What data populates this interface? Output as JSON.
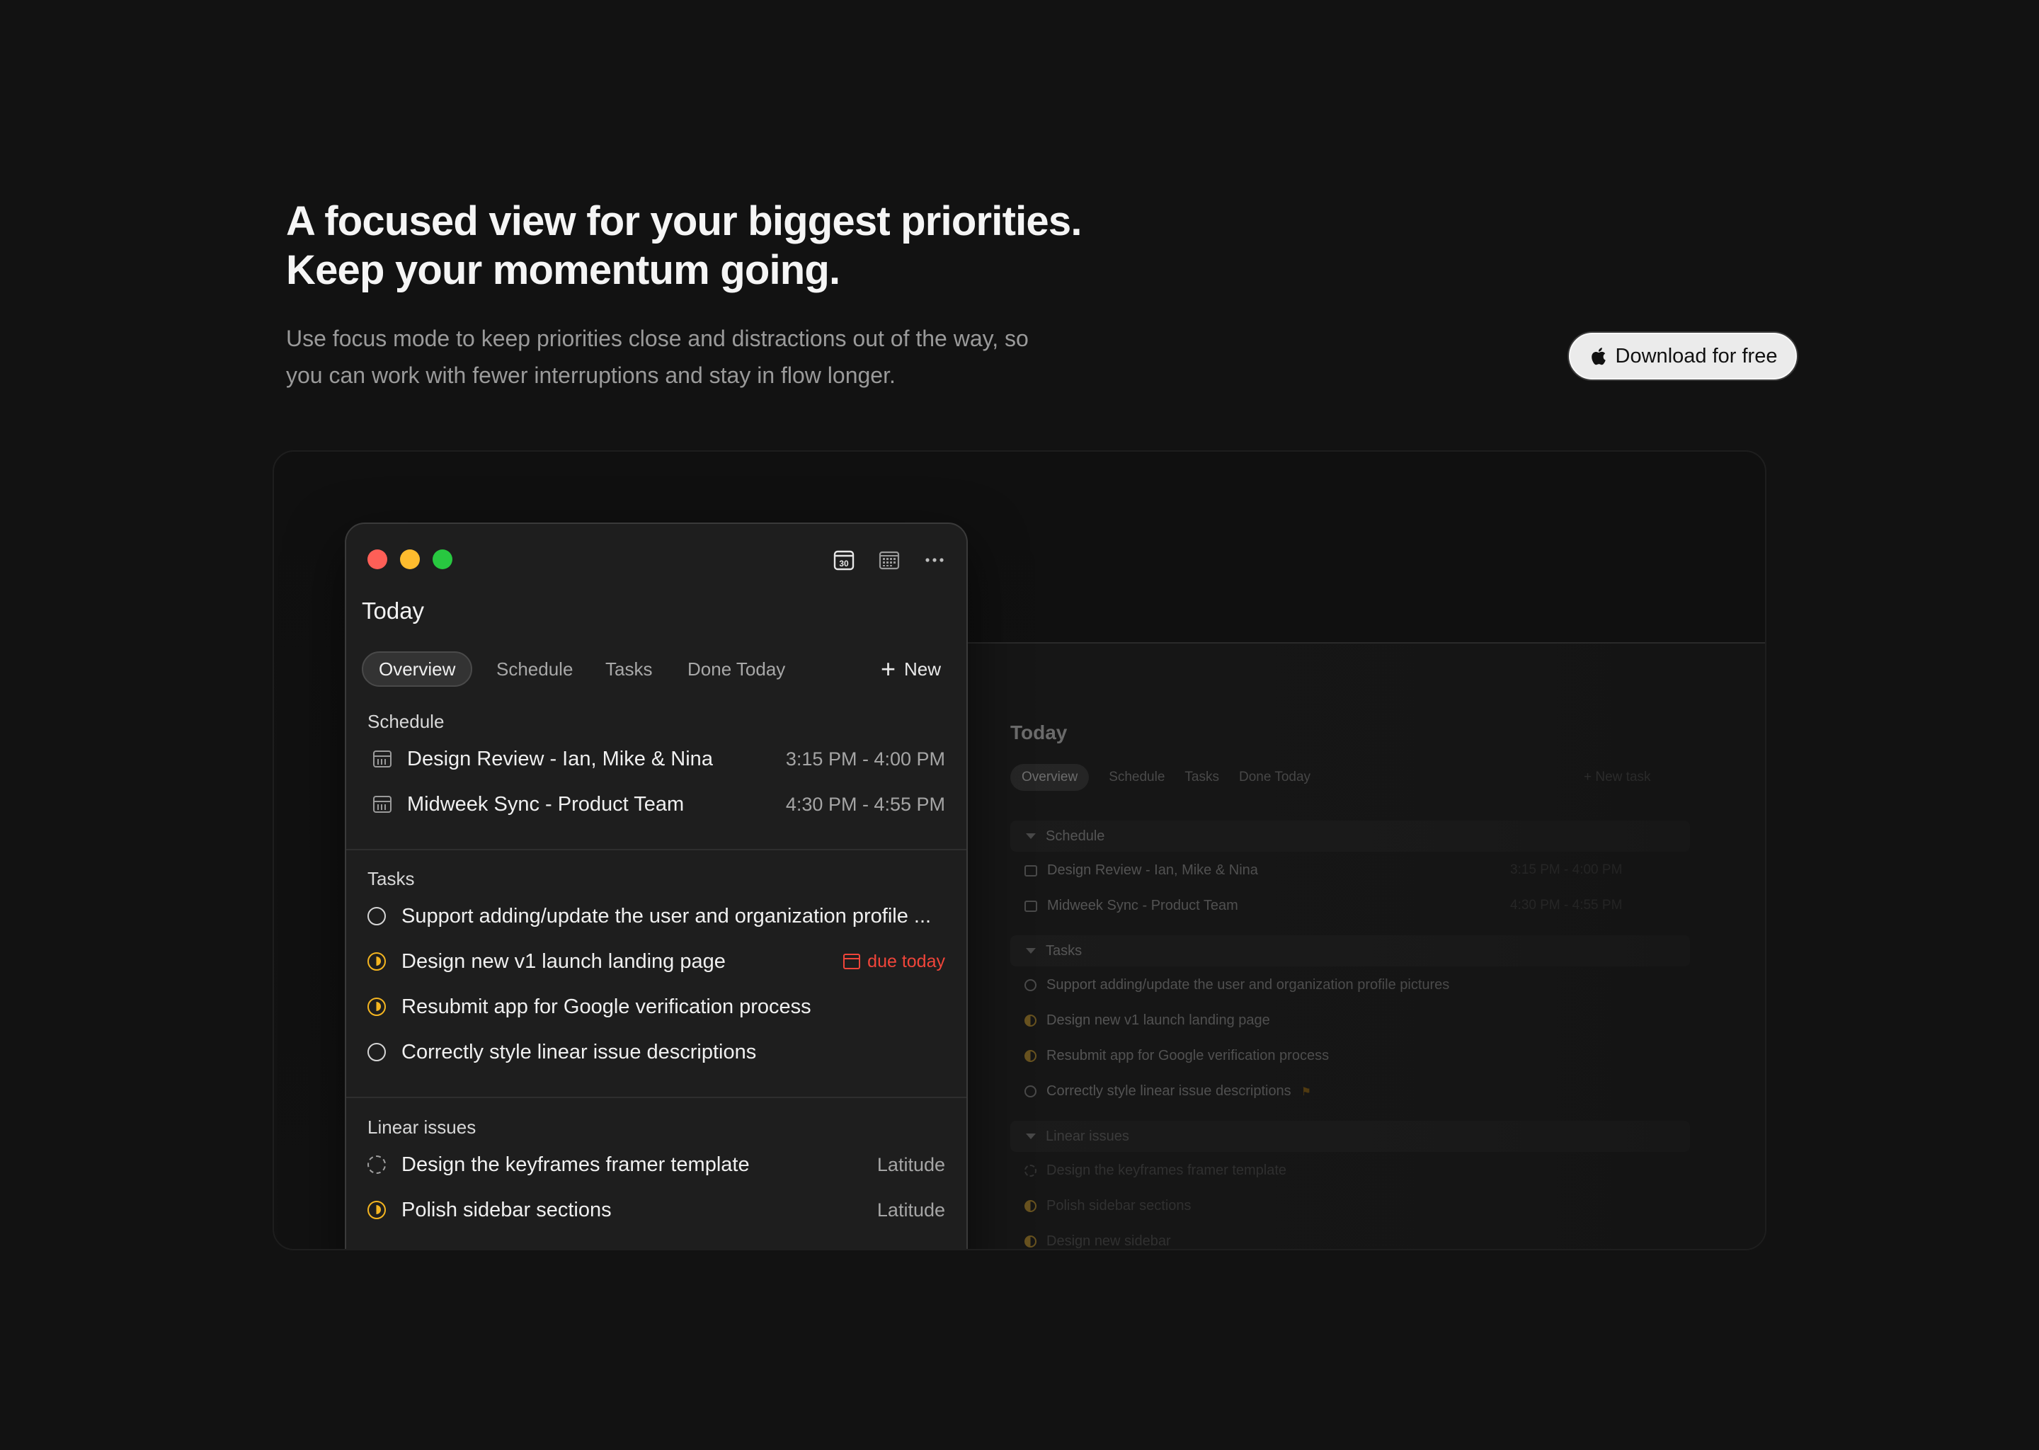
{
  "hero": {
    "headline_line1": "A focused view for your biggest priorities.",
    "headline_line2": "Keep your momentum going.",
    "subtext": "Use focus mode to keep priorities close and distractions out of the way, so you can work with fewer interruptions and stay in flow longer.",
    "download_label": "Download for free",
    "download_icon": "apple-icon"
  },
  "focus_window": {
    "traffic_lights": [
      "close",
      "minimize",
      "zoom"
    ],
    "tool_icons": [
      "calendar-day-icon",
      "calendar-grid-icon",
      "more-icon"
    ],
    "calendar_day_number": "30",
    "title": "Today",
    "tabs": [
      "Overview",
      "Schedule",
      "Tasks",
      "Done Today"
    ],
    "active_tab": "Overview",
    "new_label": "New",
    "schedule": {
      "label": "Schedule",
      "items": [
        {
          "title": "Design Review - Ian, Mike & Nina",
          "time": "3:15 PM - 4:00 PM"
        },
        {
          "title": "Midweek Sync - Product Team",
          "time": "4:30 PM - 4:55 PM"
        }
      ]
    },
    "tasks": {
      "label": "Tasks",
      "items": [
        {
          "title": "Support adding/update the user and organization profile ...",
          "status": "todo",
          "meta": ""
        },
        {
          "title": "Design new v1 launch landing page",
          "status": "in-progress",
          "meta": "due today"
        },
        {
          "title": "Resubmit app for Google verification process",
          "status": "in-progress",
          "meta": ""
        },
        {
          "title": "Correctly style linear issue descriptions",
          "status": "todo",
          "meta": ""
        }
      ]
    },
    "linear": {
      "label": "Linear issues",
      "items": [
        {
          "title": "Design the keyframes framer template",
          "status": "backlog",
          "team": "Latitude"
        },
        {
          "title": "Polish sidebar sections",
          "status": "in-progress",
          "team": "Latitude"
        }
      ]
    }
  },
  "background_window": {
    "title": "Today",
    "tabs": [
      "Overview",
      "Schedule",
      "Tasks",
      "Done Today"
    ],
    "new_label": "+ New task",
    "sections": [
      "Schedule",
      "Tasks",
      "Linear issues"
    ],
    "schedule_items": [
      {
        "title": "Design Review - Ian, Mike & Nina",
        "time": "3:15 PM - 4:00 PM"
      },
      {
        "title": "Midweek Sync - Product Team",
        "time": "4:30 PM - 4:55 PM"
      }
    ],
    "task_items": [
      "Support adding/update the user and organization profile pictures",
      "Design new v1 launch landing page",
      "Resubmit app for Google verification process",
      "Correctly style linear issue descriptions"
    ],
    "linear_items": [
      "Design the keyframes framer template",
      "Polish sidebar sections",
      "Design new sidebar"
    ]
  },
  "colors": {
    "page_bg": "#121212",
    "accent_yellow": "#f4b520",
    "due_red": "#f0453a",
    "traffic_red": "#fe5f57",
    "traffic_yellow": "#febc2e",
    "traffic_green": "#28c840"
  }
}
